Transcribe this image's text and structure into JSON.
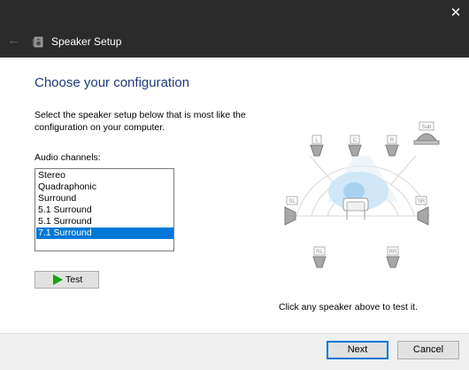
{
  "window": {
    "title": "Speaker Setup",
    "close_glyph": "✕",
    "back_glyph": "←"
  },
  "page": {
    "heading": "Choose your configuration",
    "instruction": "Select the speaker setup below that is most like the configuration on your computer.",
    "channels_label": "Audio channels:",
    "channels": [
      "Stereo",
      "Quadraphonic",
      "Surround",
      "5.1 Surround",
      "5.1 Surround",
      "7.1 Surround"
    ],
    "selected_channel": "7.1 Surround",
    "test_label": "Test",
    "hint": "Click any speaker above to test it."
  },
  "speakers": {
    "front_left": "L",
    "center": "C",
    "front_right": "R",
    "subwoofer": "Sub",
    "side_left": "SL",
    "side_right": "SR",
    "rear_left": "RL",
    "rear_right": "RR"
  },
  "footer": {
    "next_label": "Next",
    "cancel_label": "Cancel"
  },
  "colors": {
    "heading": "#1e3c78",
    "selection": "#0078d7",
    "titlebar": "#2b2b2b",
    "test_icon": "#12a312"
  }
}
